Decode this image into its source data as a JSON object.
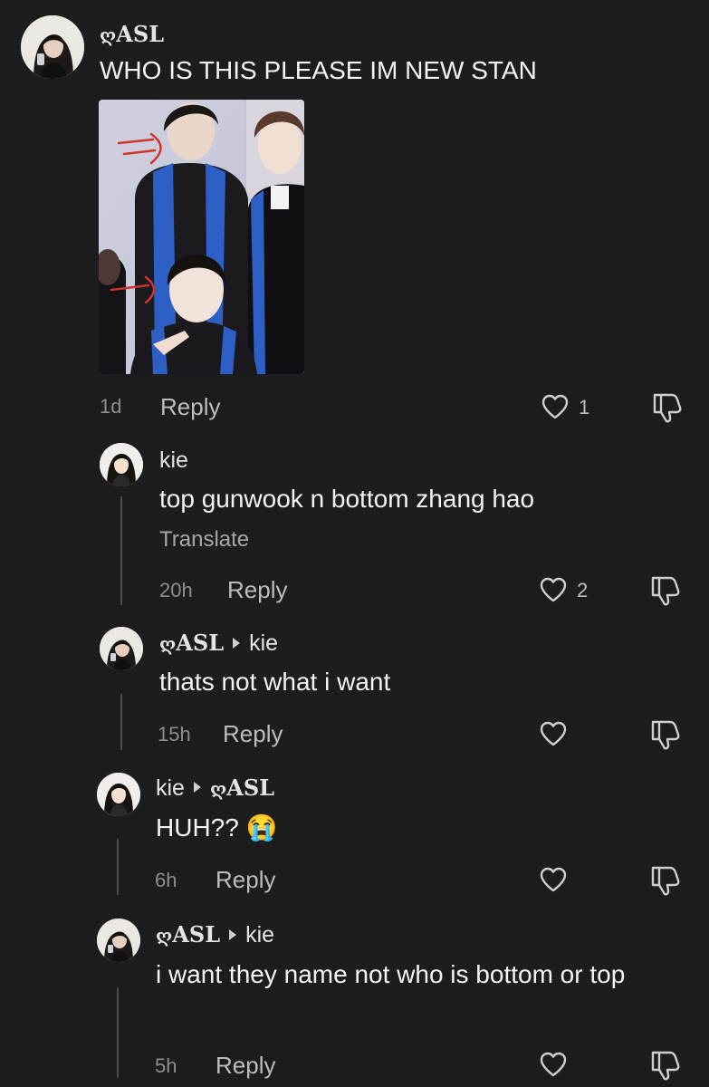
{
  "comments": [
    {
      "id": "c1",
      "user": "ASL",
      "text": "WHO IS THIS PLEASE IM NEW STAN",
      "time": "1d",
      "reply_label": "Reply",
      "likes": "1"
    },
    {
      "id": "c2",
      "user": "kie",
      "text": "top gunwook n bottom zhang hao",
      "translate_label": "Translate",
      "time": "20h",
      "reply_label": "Reply",
      "likes": "2"
    },
    {
      "id": "c3",
      "user": "ASL",
      "reply_to": "kie",
      "text": "thats not what i want",
      "time": "15h",
      "reply_label": "Reply"
    },
    {
      "id": "c4",
      "user": "kie",
      "reply_to": "ASL",
      "text": "HUH?? 😭",
      "time": "6h",
      "reply_label": "Reply"
    },
    {
      "id": "c5",
      "user": "ASL",
      "reply_to": "kie",
      "text": "i want they name not who is bottom or top",
      "time": "5h",
      "reply_label": "Reply"
    }
  ],
  "user_prefix_symbol": "ღ",
  "colors": {
    "background": "#1d1d1e",
    "text": "#f4f4f4",
    "muted": "#8e8e8e",
    "sash_blue": "#2e5fc4"
  },
  "icons": [
    "heart-icon",
    "dislike-icon",
    "reply-arrow-icon"
  ]
}
